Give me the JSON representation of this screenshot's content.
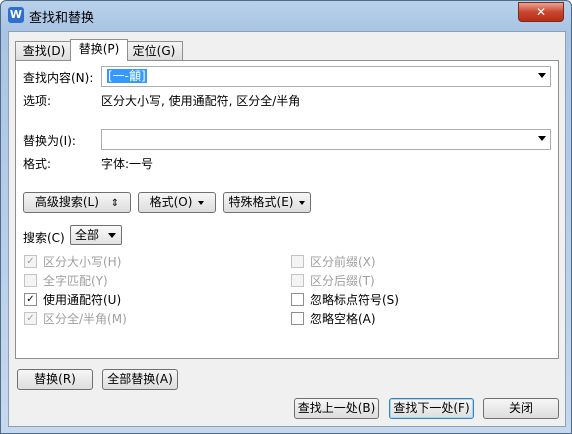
{
  "window": {
    "title": "查找和替换",
    "close_symbol": "✕",
    "app_icon_letter": "W"
  },
  "tabs": [
    {
      "label": "查找(D)",
      "active": false
    },
    {
      "label": "替换(P)",
      "active": true
    },
    {
      "label": "定位(G)",
      "active": false
    }
  ],
  "find": {
    "label": "查找内容(N):",
    "value": "[一-龥]"
  },
  "options": {
    "label": "选项:",
    "value": "区分大小写, 使用通配符, 区分全/半角"
  },
  "replace": {
    "label": "替换为(I):",
    "value": ""
  },
  "format": {
    "label": "格式:",
    "value": "字体:一号"
  },
  "buttons": {
    "advanced": "高级搜索(L)",
    "advanced_symbol": "⇕",
    "format": "格式(O)",
    "special": "特殊格式(E)",
    "replace": "替换(R)",
    "replace_all": "全部替换(A)",
    "find_prev": "查找上一处(B)",
    "find_next": "查找下一处(F)",
    "close": "关闭"
  },
  "search": {
    "label": "搜索(C)",
    "value": "全部"
  },
  "checkboxes_left": [
    {
      "label": "区分大小写(H)",
      "checked": true,
      "disabled": true
    },
    {
      "label": "全字匹配(Y)",
      "checked": false,
      "disabled": true
    },
    {
      "label": "使用通配符(U)",
      "checked": true,
      "disabled": false
    },
    {
      "label": "区分全/半角(M)",
      "checked": true,
      "disabled": true
    }
  ],
  "checkboxes_right": [
    {
      "label": "区分前缀(X)",
      "checked": false,
      "disabled": true
    },
    {
      "label": "区分后缀(T)",
      "checked": false,
      "disabled": true
    },
    {
      "label": "忽略标点符号(S)",
      "checked": false,
      "disabled": false
    },
    {
      "label": "忽略空格(A)",
      "checked": false,
      "disabled": false
    }
  ],
  "check_mark": "✓"
}
